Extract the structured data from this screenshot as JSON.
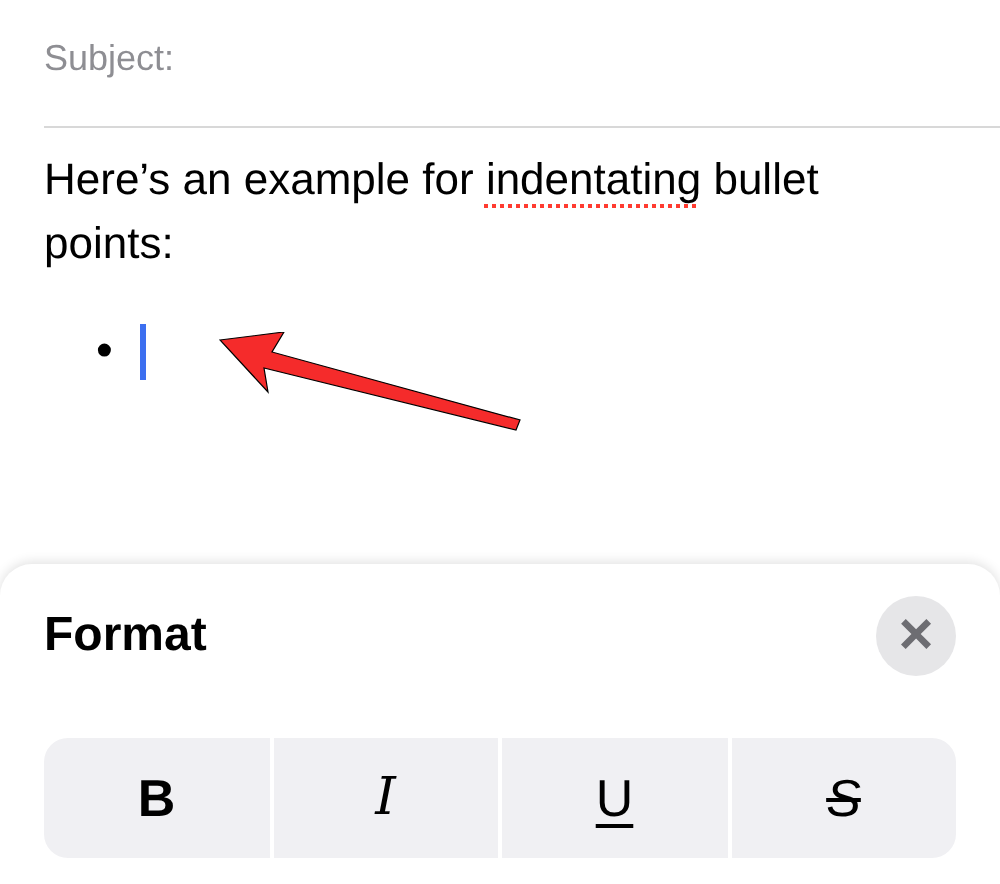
{
  "subject": {
    "label": "Subject:"
  },
  "body": {
    "segments": [
      {
        "text": "Here’s an example for ",
        "misspelled": false
      },
      {
        "text": "indentating",
        "misspelled": true
      },
      {
        "text": " bullet points:",
        "misspelled": false
      }
    ],
    "bullet": "•"
  },
  "format_sheet": {
    "title": "Format",
    "close": "×",
    "styles": [
      {
        "kind": "bold",
        "label": "B"
      },
      {
        "kind": "italic",
        "label": "I"
      },
      {
        "kind": "underline",
        "label": "U"
      },
      {
        "kind": "strikethrough",
        "label": "S"
      }
    ]
  }
}
